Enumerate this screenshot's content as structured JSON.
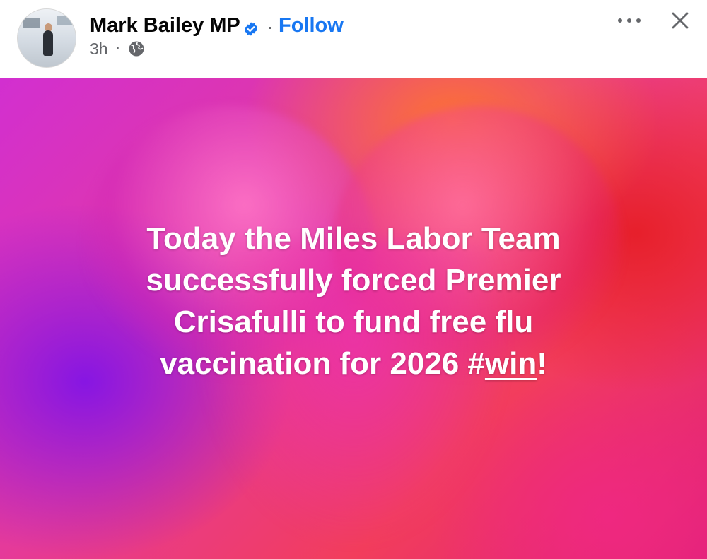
{
  "post": {
    "author": "Mark Bailey MP",
    "follow_label": "Follow",
    "separator": "·",
    "time": "3h",
    "time_separator": "·",
    "audience_icon": "globe-icon",
    "verified_icon": "verified-badge-icon",
    "more_icon": "more-options-icon",
    "close_icon": "close-icon",
    "text_lines": [
      "Today the Miles Labor Team",
      "successfully forced Premier",
      "Crisafulli to fund free flu",
      "vaccination for 2026 #"
    ],
    "hashtag_link": "win",
    "text_end": "!",
    "colors": {
      "follow": "#1877f2",
      "verified": "#1877f2",
      "secondary_text": "#65676b",
      "post_text": "#ffffff"
    }
  }
}
